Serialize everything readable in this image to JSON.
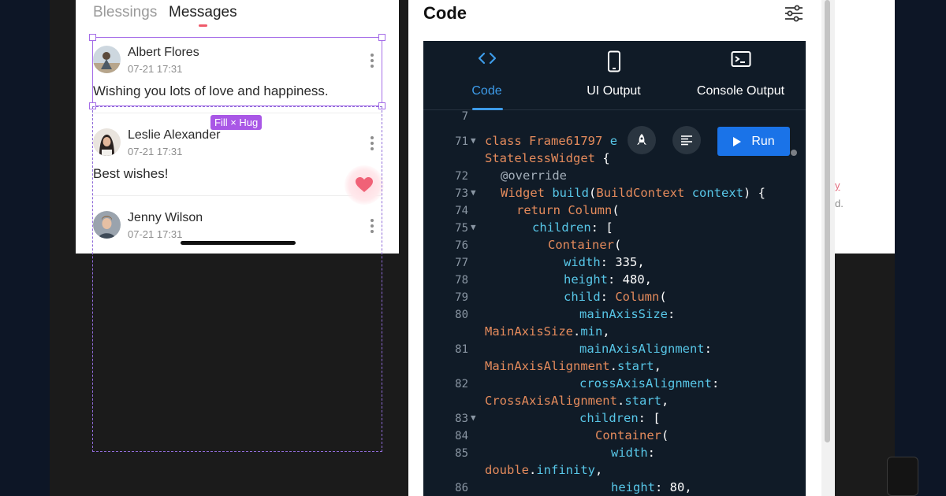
{
  "preview": {
    "tabs": [
      "Blessings",
      "Messages"
    ],
    "active_tab": "Messages",
    "messages": [
      {
        "sender": "Albert Flores",
        "time": "07-21 17:31",
        "body": "Wishing you lots of love and happiness."
      },
      {
        "sender": "Leslie Alexander",
        "time": "07-21 17:31",
        "body": "Best wishes!"
      },
      {
        "sender": "Jenny Wilson",
        "time": "07-21 17:31",
        "body": ""
      }
    ],
    "selection_badge": "Fill × Hug"
  },
  "code_panel": {
    "title": "Code",
    "tabs": [
      {
        "label": "Code",
        "icon": "code-icon"
      },
      {
        "label": "UI Output",
        "icon": "phone-icon"
      },
      {
        "label": "Console Output",
        "icon": "terminal-icon"
      }
    ],
    "active_tab": "Code",
    "run_label": "Run",
    "lines": [
      {
        "n": "",
        "text": ""
      },
      {
        "n": "71",
        "text": "class Frame61797 e"
      },
      {
        "n": "",
        "text": "StatelessWidget {"
      },
      {
        "n": "72",
        "text": "@override"
      },
      {
        "n": "73",
        "text": "Widget build(BuildContext context) {"
      },
      {
        "n": "74",
        "text": "return Column("
      },
      {
        "n": "75",
        "text": "children: ["
      },
      {
        "n": "76",
        "text": "Container("
      },
      {
        "n": "77",
        "text": "width: 335,"
      },
      {
        "n": "78",
        "text": "height: 480,"
      },
      {
        "n": "79",
        "text": "child: Column("
      },
      {
        "n": "80",
        "text": "mainAxisSize:"
      },
      {
        "n": "",
        "text": "MainAxisSize.min,"
      },
      {
        "n": "81",
        "text": "mainAxisAlignment:"
      },
      {
        "n": "",
        "text": "MainAxisAlignment.start,"
      },
      {
        "n": "82",
        "text": "crossAxisAlignment:"
      },
      {
        "n": "",
        "text": "CrossAxisAlignment.start,"
      },
      {
        "n": "83",
        "text": "children: ["
      },
      {
        "n": "84",
        "text": "Container("
      },
      {
        "n": "85",
        "text": "width:"
      },
      {
        "n": "",
        "text": "double.infinity,"
      },
      {
        "n": "86",
        "text": "height: 80,"
      }
    ]
  },
  "peek": {
    "text_a": "y",
    "text_b": "d."
  },
  "colors": {
    "accent": "#3d9be9",
    "run": "#1a73e8",
    "selection": "#a56de8",
    "heart": "#f06277"
  }
}
